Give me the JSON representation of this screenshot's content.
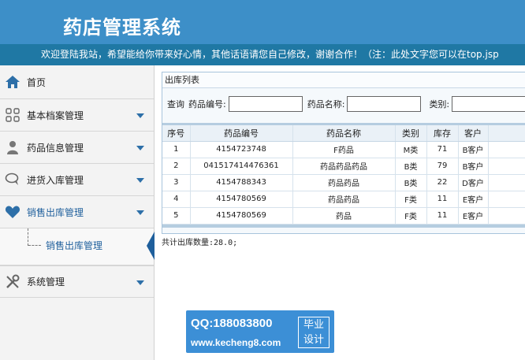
{
  "header": {
    "title": "药店管理系统"
  },
  "banner": {
    "text": "欢迎登陆我站，希望能给你带来好心情，其他话语请您自己修改，谢谢合作！（注：此处文字您可以在top.jsp"
  },
  "sidebar": {
    "home": "首页",
    "items": [
      {
        "label": "基本档案管理",
        "icon": "grid-icon"
      },
      {
        "label": "药品信息管理",
        "icon": "person-icon"
      },
      {
        "label": "进货入库管理",
        "icon": "chat-icon"
      },
      {
        "label": "销售出库管理",
        "icon": "heart-icon"
      }
    ],
    "sub_item": "销售出库管理",
    "system": "系统管理"
  },
  "panel": {
    "title": "出库列表",
    "query_label": "查询",
    "code_label": "药品编号:",
    "name_label": "药品名称:",
    "category_label": "类别:"
  },
  "table": {
    "headers": [
      "序号",
      "药品编号",
      "药品名称",
      "类别",
      "库存",
      "客户"
    ],
    "rows": [
      [
        "1",
        "4154723748",
        "F药品",
        "M类",
        "71",
        "B客户"
      ],
      [
        "2",
        "041517414476361",
        "药品药品药品",
        "B类",
        "79",
        "B客户"
      ],
      [
        "3",
        "4154788343",
        "药品药品",
        "B类",
        "22",
        "D客户"
      ],
      [
        "4",
        "4154780569",
        "药品药品",
        "F类",
        "11",
        "E客户"
      ],
      [
        "5",
        "4154780569",
        "药品",
        "F类",
        "11",
        "E客户"
      ]
    ]
  },
  "total": "共计出库数量:28.0;",
  "watermark": {
    "qq": "QQ:188083800",
    "site": "www.kecheng8.com",
    "badge_line1": "毕业",
    "badge_line2": "设计"
  },
  "colors": {
    "header": "#3d8fc8",
    "banner": "#1f78a4",
    "accent": "#2d6fa8"
  }
}
